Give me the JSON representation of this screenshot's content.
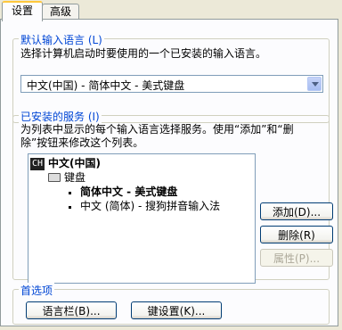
{
  "tabs": [
    {
      "label": "设置",
      "active": true
    },
    {
      "label": "高级",
      "active": false
    }
  ],
  "default_language": {
    "group_title": "默认输入语言 (L)",
    "description": "选择计算机启动时要使用的一个已安装的输入语言。",
    "selected": "中文(中国) - 简体中文 - 美式键盘"
  },
  "installed_services": {
    "group_title": "已安装的服务 (I)",
    "description_line1": "为列表中显示的每个输入语言选择服务。使用“添加”和“删",
    "description_line2": "除”按钮来修改这个列表。",
    "tree": {
      "language_badge": "CH",
      "language": "中文(中国)",
      "category": "键盘",
      "items": [
        {
          "label": "简体中文 - 美式键盘",
          "bold": true
        },
        {
          "label": "中文 (简体) - 搜狗拼音输入法",
          "bold": false
        }
      ]
    },
    "buttons": {
      "add": "添加(D)...",
      "remove": "删除(R)",
      "properties": "属性(P)..."
    }
  },
  "preferences": {
    "group_title": "首选项",
    "language_bar": "语言栏(B)...",
    "key_settings": "键设置(K)..."
  },
  "colors": {
    "group_title": "#0046d5",
    "tab_highlight": "#ffc83c",
    "dialog_bg": "#ece9d8"
  }
}
